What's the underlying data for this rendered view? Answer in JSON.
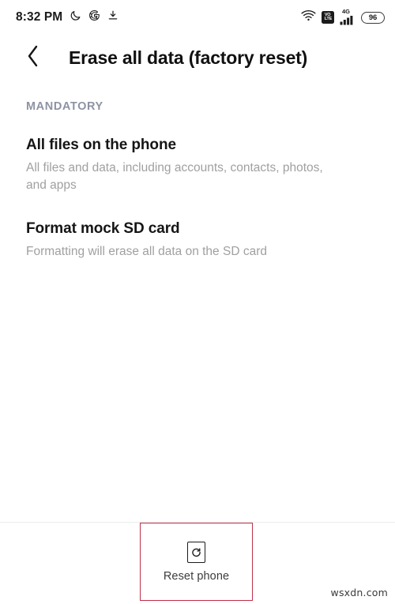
{
  "status_bar": {
    "clock": "8:32 PM",
    "left_icons": [
      {
        "name": "moon-icon",
        "label": "Do not disturb"
      },
      {
        "name": "google-g-icon",
        "label": "Google"
      },
      {
        "name": "download-icon",
        "label": "Download"
      }
    ],
    "right_icons": [
      {
        "name": "wifi-icon",
        "label": "Wi-Fi"
      },
      {
        "name": "volte-icon",
        "label_top": "VO",
        "label_bottom": "LTE"
      },
      {
        "name": "cellular-signal-icon",
        "network": "4G"
      }
    ],
    "battery": {
      "level": "96"
    }
  },
  "app_bar": {
    "back_label": "Back",
    "title": "Erase all data (factory reset)"
  },
  "content": {
    "section_header": "MANDATORY",
    "items": [
      {
        "title": "All files on the phone",
        "subtitle": "All files and data, including accounts, contacts, photos, and apps"
      },
      {
        "title": "Format mock SD card",
        "subtitle": "Formatting will erase all data on the SD card"
      }
    ]
  },
  "bottom_bar": {
    "reset_button": {
      "label": "Reset phone",
      "icon": "reset-phone-icon"
    }
  },
  "annotation": {
    "highlight_color": "#c0304a"
  },
  "watermark": {
    "text": "wsxdn.com"
  },
  "colors": {
    "background": "#ffffff",
    "title_text": "#111111",
    "item_title": "#151515",
    "item_subtitle": "#a0a0a0",
    "section_header": "#8d93a3",
    "divider": "#ededed",
    "highlight": "#c0304a"
  }
}
